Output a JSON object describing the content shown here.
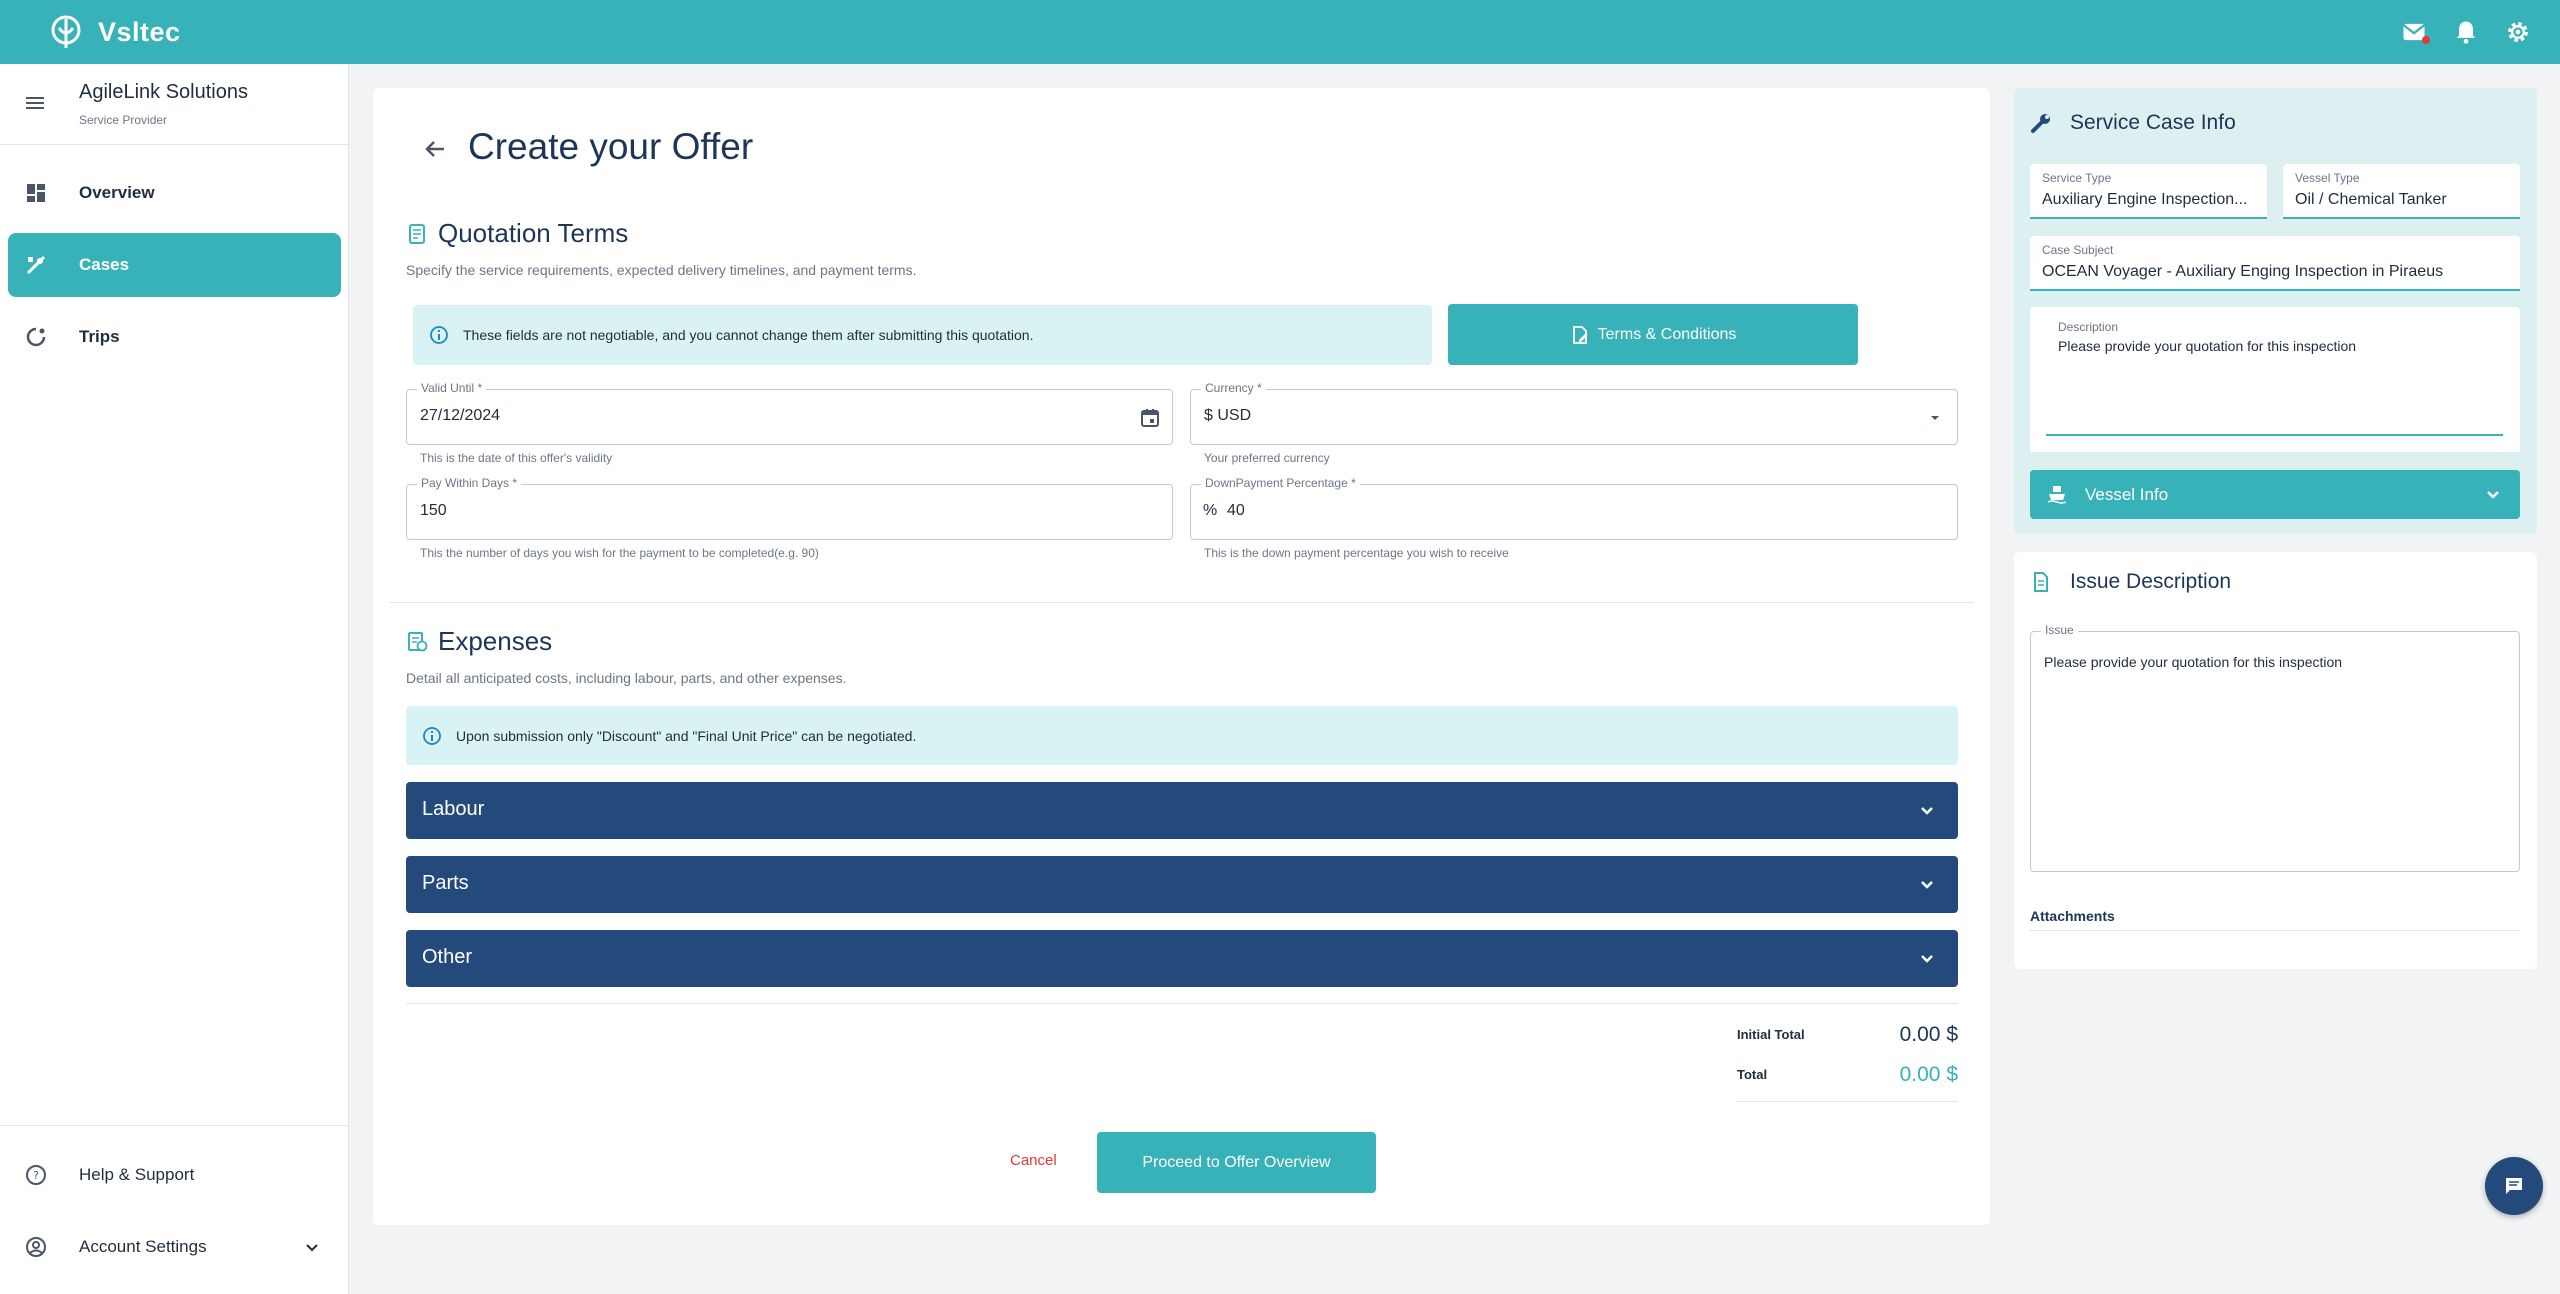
{
  "app": {
    "name": "Vsltec"
  },
  "header": {
    "icons": [
      "mail-icon",
      "bell-icon",
      "gear-icon"
    ]
  },
  "sidebar": {
    "org_name": "AgileLink Solutions",
    "org_role": "Service Provider",
    "items": [
      {
        "label": "Overview",
        "icon": "dashboard-icon"
      },
      {
        "label": "Cases",
        "icon": "tools-icon",
        "active": true
      },
      {
        "label": "Trips",
        "icon": "route-icon"
      }
    ],
    "help_label": "Help & Support",
    "account_label": "Account Settings"
  },
  "main": {
    "title": "Create your Offer",
    "quotation": {
      "title": "Quotation Terms",
      "subtitle": "Specify the service requirements, expected delivery timelines, and payment terms.",
      "notice": "These fields are not negotiable, and you cannot change them after submitting this quotation.",
      "terms_button": "Terms & Conditions",
      "valid_until": {
        "label": "Valid Until *",
        "value": "27/12/2024",
        "helper": "This is the date of this offer's validity"
      },
      "currency": {
        "label": "Currency *",
        "value": "$ USD",
        "helper": "Your preferred currency"
      },
      "pay_within": {
        "label": "Pay Within Days *",
        "value": "150",
        "helper": "This the number of days you wish for the payment to be completed(e.g. 90)"
      },
      "down_payment": {
        "label": "DownPayment Percentage *",
        "prefix": "%",
        "value": "40",
        "helper": "This is the down payment percentage you wish to receive"
      }
    },
    "expenses": {
      "title": "Expenses",
      "subtitle": "Detail all anticipated costs, including labour, parts, and other expenses.",
      "notice": "Upon submission only \"Discount\" and \"Final Unit Price\" can be negotiated.",
      "sections": [
        "Labour",
        "Parts",
        "Other"
      ]
    },
    "totals": {
      "initial_label": "Initial Total",
      "initial_value": "0.00 $",
      "total_label": "Total",
      "total_value": "0.00 $"
    },
    "cancel_label": "Cancel",
    "proceed_label": "Proceed to Offer Overview"
  },
  "service_case": {
    "title": "Service Case Info",
    "service_type": {
      "label": "Service Type",
      "value": "Auxiliary Engine Inspection..."
    },
    "vessel_type": {
      "label": "Vessel Type",
      "value": "Oil / Chemical Tanker"
    },
    "case_subject": {
      "label": "Case Subject",
      "value": "OCEAN Voyager - Auxiliary Enging Inspection in Piraeus"
    },
    "description": {
      "label": "Description",
      "value": "Please provide your quotation for this inspection"
    },
    "vessel_info_label": "Vessel Info"
  },
  "issue": {
    "title": "Issue Description",
    "field_label": "Issue",
    "value": "Please provide your quotation for this inspection",
    "attachments_label": "Attachments"
  },
  "colors": {
    "accent": "#38b2b9",
    "navy": "#244a7c",
    "danger": "#e53935"
  }
}
